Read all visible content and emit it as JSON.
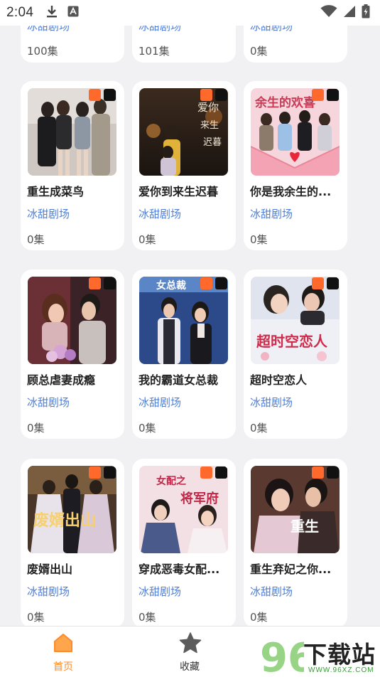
{
  "status_bar": {
    "time": "2:04",
    "icons": [
      "download-icon",
      "notification-a-icon",
      "wifi-icon",
      "signal-icon",
      "battery-icon"
    ]
  },
  "feed": {
    "partial_row": [
      {
        "source": "冰甜剧场",
        "episodes": "100集"
      },
      {
        "source": "冰甜剧场",
        "episodes": "101集"
      },
      {
        "source": "冰甜剧场",
        "episodes": "0集"
      }
    ],
    "cards": [
      {
        "title": "重生成菜鸟",
        "source": "冰甜剧场",
        "episodes": "0集",
        "cover_text": ""
      },
      {
        "title": "爱你到来生迟暮",
        "source": "冰甜剧场",
        "episodes": "0集",
        "cover_text": "爱你到来生迟暮"
      },
      {
        "title": "你是我余生的...",
        "source": "冰甜剧场",
        "episodes": "0集",
        "cover_text": "你是我余生的欢喜"
      },
      {
        "title": "顾总虐妻成瘾",
        "source": "冰甜剧场",
        "episodes": "0集",
        "cover_text": ""
      },
      {
        "title": "我的霸道女总裁",
        "source": "冰甜剧场",
        "episodes": "0集",
        "cover_text": "女总裁"
      },
      {
        "title": "超时空恋人",
        "source": "冰甜剧场",
        "episodes": "0集",
        "cover_text": "超时空恋人"
      },
      {
        "title": "废婿出山",
        "source": "冰甜剧场",
        "episodes": "0集",
        "cover_text": "废婿出山"
      },
      {
        "title": "穿成恶毒女配...",
        "source": "冰甜剧场",
        "episodes": "0集",
        "cover_text": "女配之将军府"
      },
      {
        "title": "重生弃妃之你...",
        "source": "冰甜剧场",
        "episodes": "0集",
        "cover_text": "重生"
      }
    ]
  },
  "bottom_nav": {
    "items": [
      {
        "label": "首页",
        "icon": "home-icon",
        "active": true
      },
      {
        "label": "收藏",
        "icon": "star-icon",
        "active": false
      }
    ]
  },
  "watermark": {
    "number": "96",
    "text": "下载站",
    "url": "WWW.96XZ.COM"
  },
  "colors": {
    "accent": "#ff8a2a",
    "source_blue": "#4f7fd6",
    "kuaishou_orange": "#ff6a2c",
    "douyin_black": "#111111",
    "background": "#f1f1f3"
  }
}
